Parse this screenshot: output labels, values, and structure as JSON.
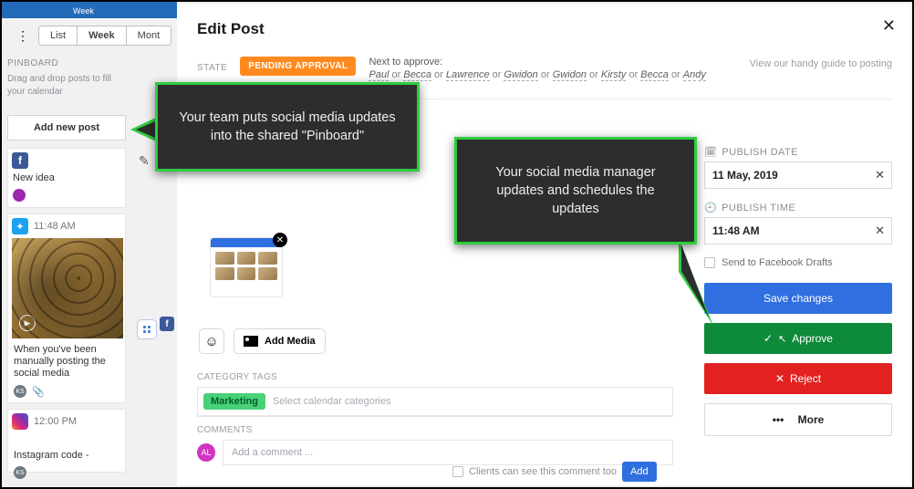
{
  "topnav": {
    "tab_week": "Week"
  },
  "viewseg": {
    "list": "List",
    "week": "Week",
    "month": "Mont"
  },
  "pinboard": {
    "header": "PINBOARD",
    "hint": "Drag and drop posts to fill your calendar",
    "add_new": "Add new post",
    "card1_title": "New idea",
    "card2_time": "11:48 AM",
    "card2_caption": "When you've been manually posting the social media",
    "card3_time": "12:00 PM",
    "card3_title": "Instagram code -"
  },
  "modal": {
    "title": "Edit Post",
    "state_label": "STATE",
    "state_badge": "PENDING APPROVAL",
    "approve_hdr": "Next to approve:",
    "approvers": [
      "Paul",
      "Becca",
      "Lawrence",
      "Gwidon",
      "Gwidon",
      "Kirsty",
      "Becca",
      "Andy"
    ],
    "or": "or",
    "guide": "View our handy guide to posting",
    "add_media": "Add Media",
    "cat_label": "CATEGORY TAGS",
    "cat_tag": "Marketing",
    "cat_placeholder": "Select calendar categories",
    "comments_label": "COMMENTS",
    "comment_placeholder": "Add a comment ...",
    "avatar_initials": "AL",
    "clients_can_see": "Clients can see this comment too",
    "add_btn": "Add"
  },
  "right": {
    "date_label": "PUBLISH DATE",
    "date_value": "11 May, 2019",
    "time_label": "PUBLISH TIME",
    "time_value": "11:48 AM",
    "fb_drafts": "Send to Facebook Drafts",
    "save": "Save changes",
    "approve": "Approve",
    "reject": "Reject",
    "more": "More"
  },
  "callouts": {
    "c1": "Your team puts social media updates into the shared \"Pinboard\"",
    "c2": "Your social media manager updates and schedules the updates"
  }
}
